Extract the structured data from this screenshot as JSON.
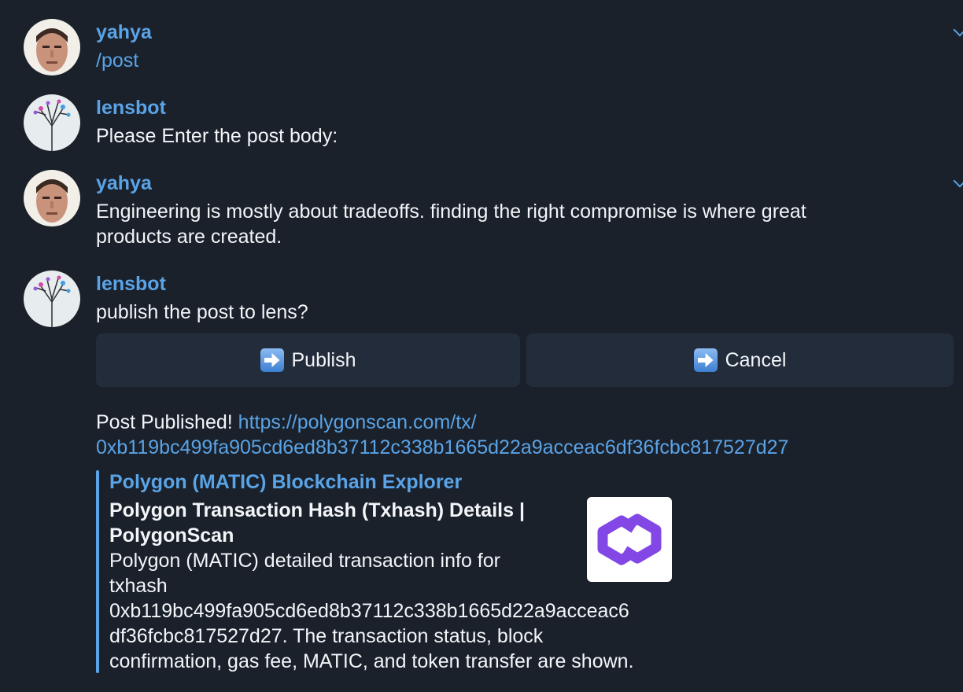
{
  "messages": [
    {
      "sender": "yahya",
      "avatar": "user-avatar",
      "text": "/post"
    },
    {
      "sender": "lensbot",
      "avatar": "bot-avatar",
      "text": "Please Enter the post body:"
    },
    {
      "sender": "yahya",
      "avatar": "user-avatar",
      "text": "Engineering is mostly about tradeoffs. finding the right compromise is where great\nproducts are created."
    },
    {
      "sender": "lensbot",
      "avatar": "bot-avatar",
      "text": "publish the post to lens?"
    }
  ],
  "keyboard": {
    "publish_label": "Publish",
    "cancel_label": "Cancel",
    "icon": "right-arrow-emoji-icon"
  },
  "published": {
    "prefix": "Post Published! ",
    "link_part1": "https://polygonscan.com/tx/",
    "link_part2": "0xb119bc499fa905cd6ed8b37112c338b1665d22a9acceac6df36fcbc817527d27"
  },
  "preview": {
    "site_name": "Polygon (MATIC) Blockchain Explorer",
    "title": "Polygon Transaction Hash (Txhash) Details |\nPolygonScan",
    "description": "Polygon (MATIC) detailed transaction info for\ntxhash\n0xb119bc499fa905cd6ed8b37112c338b1665d22a9acceac6\ndf36fcbc817527d27. The transaction status, block\nconfirmation, gas fee, MATIC, and token transfer are shown.",
    "thumbnail_icon": "polygon-logo-icon"
  },
  "colors": {
    "background": "#1a212b",
    "accent": "#5aa3e6",
    "button": "#232c3b",
    "text": "#f3f5f8",
    "polygon_purple": "#8247e5"
  }
}
